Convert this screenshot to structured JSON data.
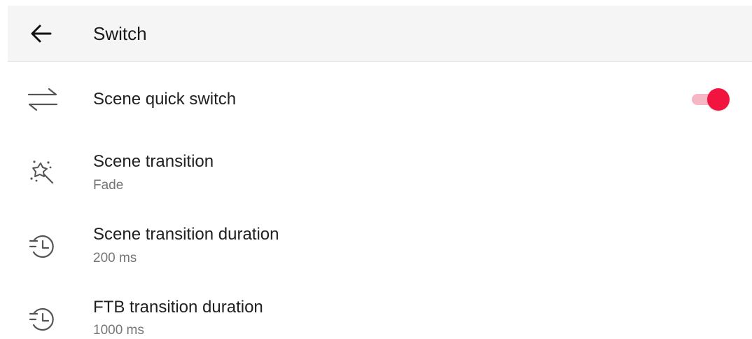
{
  "appbar": {
    "title": "Switch",
    "back_icon": "arrow-left-icon"
  },
  "settings": [
    {
      "icon": "swap-arrows-icon",
      "title": "Scene quick switch",
      "toggle": {
        "on": true
      }
    },
    {
      "icon": "magic-wand-icon",
      "title": "Scene transition",
      "summary": "Fade"
    },
    {
      "icon": "clock-history-icon",
      "title": "Scene transition duration",
      "summary": "200 ms"
    },
    {
      "icon": "clock-history-icon",
      "title": "FTB transition duration",
      "summary": "1000 ms"
    }
  ],
  "colors": {
    "accent": "#f0143f",
    "accent_track": "#f7b6c4",
    "appbar_bg": "#f5f5f5",
    "title_text": "#212121",
    "summary_text": "#757575",
    "icon": "#555555"
  }
}
